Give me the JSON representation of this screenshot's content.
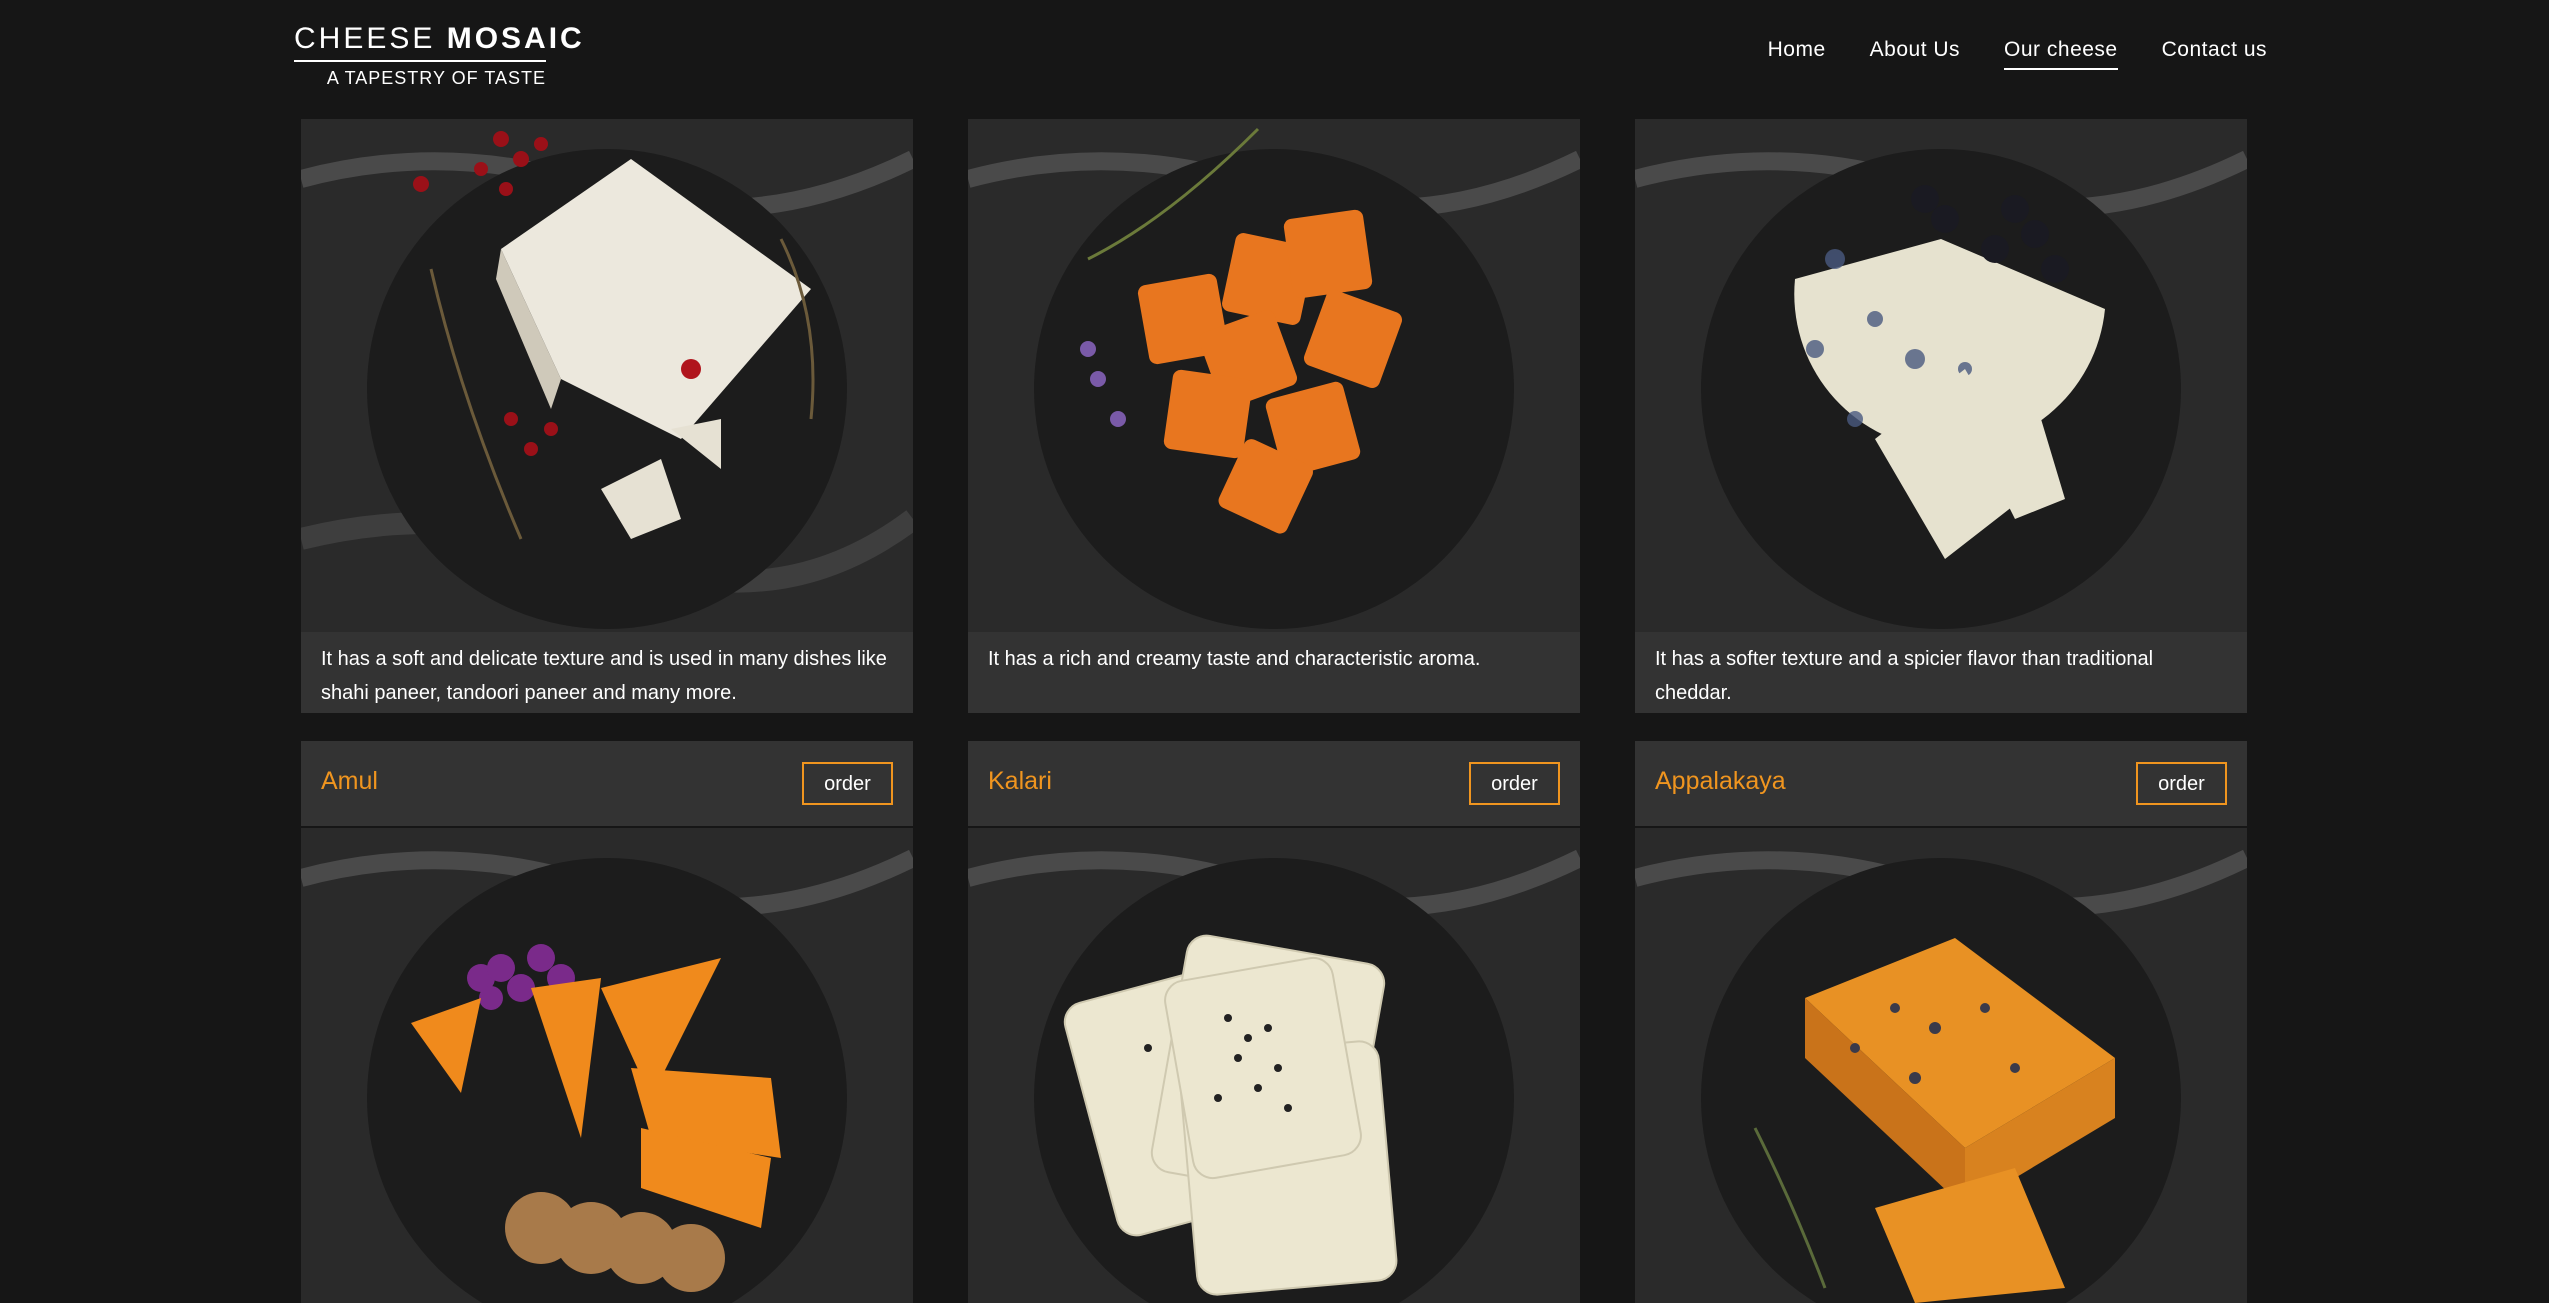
{
  "brand": {
    "word1": "CHEESE",
    "word2": "MOSAIC",
    "tagline": "A TAPESTRY OF TASTE"
  },
  "nav": [
    {
      "label": "Home",
      "active": false
    },
    {
      "label": "About Us",
      "active": false
    },
    {
      "label": "Our cheese",
      "active": true
    },
    {
      "label": "Contact us",
      "active": false
    }
  ],
  "cards": [
    {
      "description": "It has a soft and delicate texture and is used in many dishes like shahi paneer, tandoori paneer and many more.",
      "image": "white-cheese-wedge-with-cranberries",
      "cheese_color": "#ece8dd"
    },
    {
      "description": "It has a rich and creamy taste and characteristic aroma.",
      "image": "orange-crackers-with-herbs",
      "cheese_color": "#e8761f"
    },
    {
      "description": "It has a softer texture and a spicier flavor than traditional cheddar.",
      "image": "blue-cheese-wheel-with-blackberries",
      "cheese_color": "#e6e2cf"
    }
  ],
  "products": [
    {
      "name": "Amul",
      "order_label": "order",
      "image": "orange-cheese-wedges-with-crackers",
      "cheese_color": "#f08a1c"
    },
    {
      "name": "Kalari",
      "order_label": "order",
      "image": "white-cheese-slices-with-black-seeds",
      "cheese_color": "#ece7d0"
    },
    {
      "name": "Appalakaya",
      "order_label": "order",
      "image": "orange-cheese-block-with-blue-veins",
      "cheese_color": "#e89124"
    }
  ],
  "colors": {
    "accent": "#f0951f",
    "background": "#161616",
    "panel": "#333333"
  }
}
